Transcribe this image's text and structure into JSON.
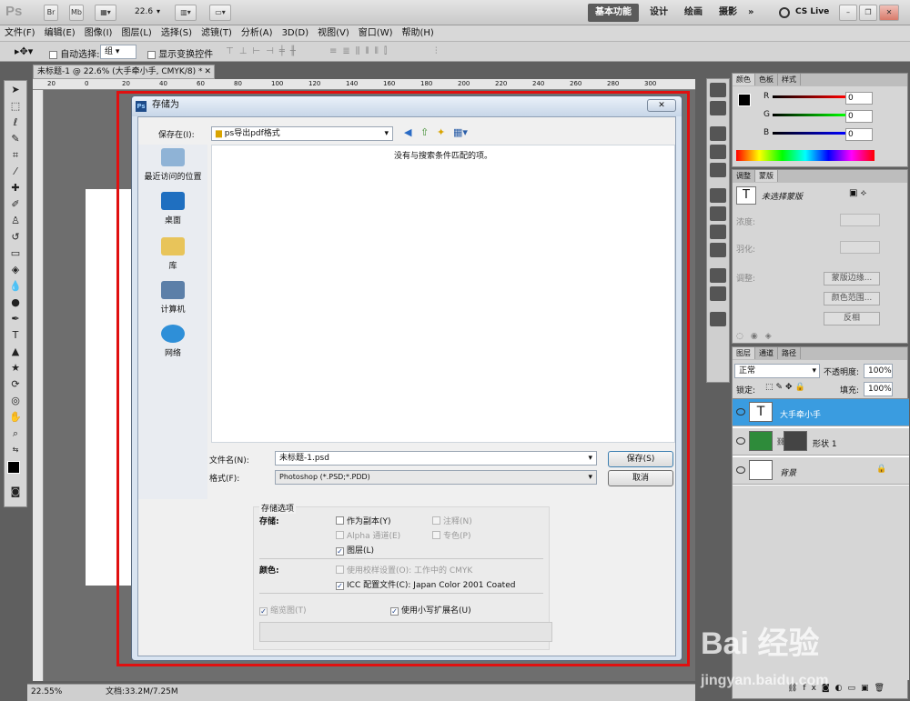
{
  "app": {
    "logo": "Ps",
    "bar_buttons": [
      "Br",
      "Mb"
    ],
    "zoom_value": "22.6",
    "workspaces": [
      "基本功能",
      "设计",
      "绘画",
      "摄影"
    ],
    "workspace_more": "»",
    "cs_live": "CS Live"
  },
  "menu": [
    "文件(F)",
    "编辑(E)",
    "图像(I)",
    "图层(L)",
    "选择(S)",
    "滤镜(T)",
    "分析(A)",
    "3D(D)",
    "视图(V)",
    "窗口(W)",
    "帮助(H)"
  ],
  "options_bar": {
    "auto_select_label": "自动选择:",
    "auto_select_value": "组",
    "show_transform_label": "显示变换控件"
  },
  "document": {
    "tab_title": "未标题-1 @ 22.6% (大手牵小手, CMYK/8) *",
    "ruler_ticks": [
      "20",
      "0",
      "20",
      "40",
      "60",
      "80",
      "100",
      "120",
      "140",
      "160",
      "180",
      "200",
      "220",
      "240",
      "260",
      "280",
      "300"
    ]
  },
  "status": {
    "zoom": "22.55%",
    "doc_info": "文档:33.2M/7.25M"
  },
  "dialog": {
    "title": "存储为",
    "save_in_label": "保存在(I):",
    "save_in_value": "ps导出pdf格式",
    "empty_message": "没有与搜索条件匹配的项。",
    "places": [
      "最近访问的位置",
      "桌面",
      "库",
      "计算机",
      "网络"
    ],
    "filename_label": "文件名(N):",
    "filename_value": "未标题-1.psd",
    "format_label": "格式(F):",
    "format_value": "Photoshop (*.PSD;*.PDD)",
    "save_button": "保存(S)",
    "cancel_button": "取消",
    "options": {
      "section_title": "存储选项",
      "save_label": "存储:",
      "as_copy": "作为副本(Y)",
      "notes": "注释(N)",
      "alpha": "Alpha 通道(E)",
      "spot": "专色(P)",
      "layers": "图层(L)",
      "color_label": "颜色:",
      "proof_setup": "使用校样设置(O):  工作中的 CMYK",
      "icc_profile": "ICC 配置文件(C):  Japan Color 2001 Coated",
      "thumbnail": "缩览图(T)",
      "lowercase_ext": "使用小写扩展名(U)"
    }
  },
  "color_panel": {
    "tabs": [
      "颜色",
      "色板",
      "样式"
    ],
    "channels": [
      {
        "label": "R",
        "value": "0"
      },
      {
        "label": "G",
        "value": "0"
      },
      {
        "label": "B",
        "value": "0"
      }
    ]
  },
  "adjust_panel": {
    "tabs": [
      "调整",
      "蒙版"
    ],
    "title": "未选择蒙版",
    "density": "浓度:",
    "feather": "羽化:",
    "refine": "调整:",
    "mask_edge": "蒙版边缘...",
    "color_range": "颜色范围...",
    "invert": "反相"
  },
  "layers_panel": {
    "tabs": [
      "图层",
      "通道",
      "路径"
    ],
    "blend_mode": "正常",
    "opacity_label": "不透明度:",
    "opacity_value": "100%",
    "lock_label": "锁定:",
    "fill_label": "填充:",
    "fill_value": "100%",
    "layers": [
      {
        "name": "大手牵小手",
        "type": "T"
      },
      {
        "name": "形状 1",
        "type": "shape"
      },
      {
        "name": "背景",
        "type": "bg"
      }
    ]
  },
  "watermark": {
    "brand": "Bai 经验",
    "url": "jingyan.baidu.com"
  },
  "colors": {
    "highlight_box": "#e01010",
    "selected_layer": "#3a9ce0",
    "shape_layer": "#2e8b3a"
  }
}
